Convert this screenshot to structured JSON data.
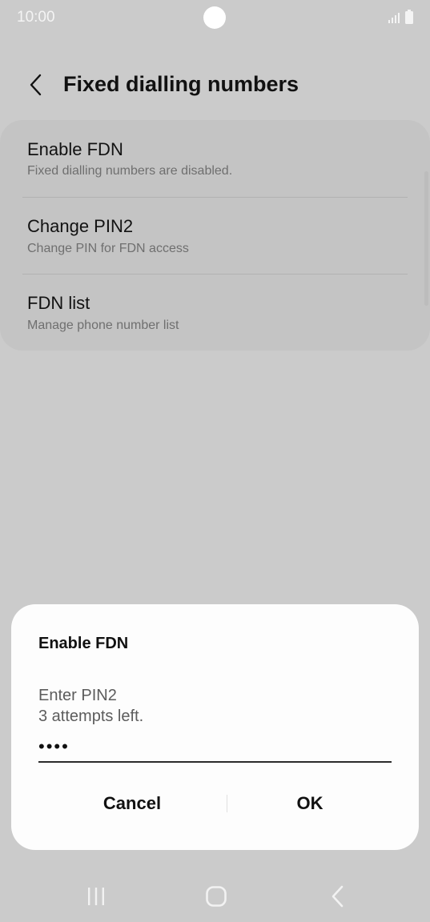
{
  "status_bar": {
    "time": "10:00"
  },
  "header": {
    "title": "Fixed dialling numbers"
  },
  "settings": {
    "items": [
      {
        "title": "Enable FDN",
        "summary": "Fixed dialling numbers are disabled."
      },
      {
        "title": "Change PIN2",
        "summary": "Change PIN for FDN access"
      },
      {
        "title": "FDN list",
        "summary": "Manage phone number list"
      }
    ]
  },
  "dialog": {
    "title": "Enable FDN",
    "prompt": "Enter PIN2",
    "attempts": "3 attempts left.",
    "pin_value": "••••",
    "cancel_label": "Cancel",
    "ok_label": "OK"
  },
  "icons": {
    "back": "chevron-left-icon",
    "signal": "signal-icon",
    "battery": "battery-icon",
    "nav_recent": "recent-apps-icon",
    "nav_home": "home-icon",
    "nav_back": "back-icon"
  },
  "colors": {
    "background": "#cbcbcb",
    "card": "#c4c4c4",
    "dialog": "#fdfdfd",
    "text_primary": "#121212",
    "text_secondary": "#6f6f6f"
  }
}
